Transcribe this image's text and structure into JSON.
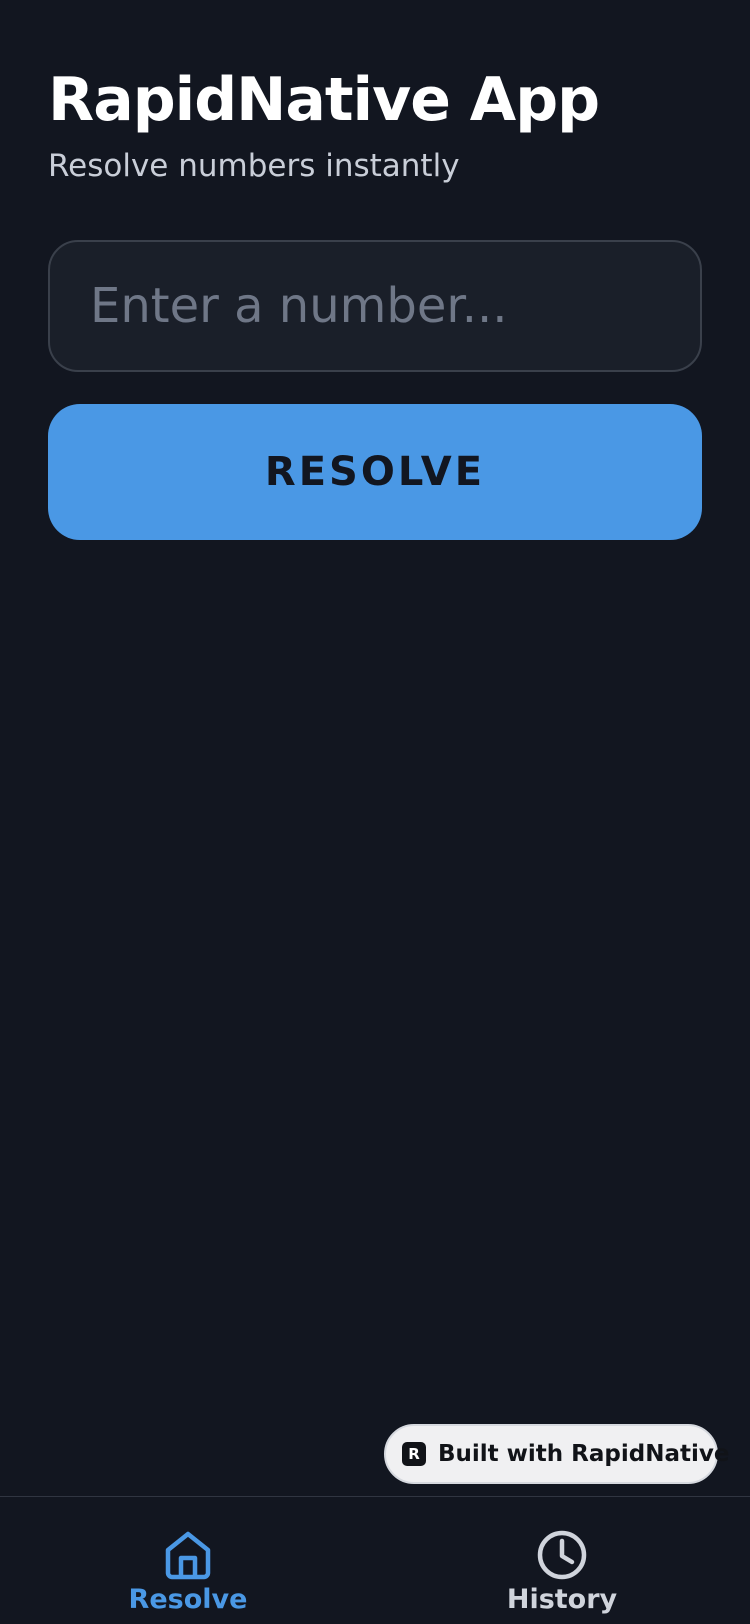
{
  "app": {
    "title": "RapidNative App",
    "subtitle": "Resolve numbers instantly"
  },
  "form": {
    "number_input": {
      "value": "",
      "placeholder": "Enter a number..."
    },
    "resolve_label": "RESOLVE"
  },
  "badge": {
    "label": "Built with RapidNative"
  },
  "bottom_nav": {
    "items": [
      {
        "label": "Resolve",
        "icon": "home-icon",
        "active": true
      },
      {
        "label": "History",
        "icon": "clock-icon",
        "active": false
      }
    ]
  },
  "colors": {
    "background": "#121620",
    "accent": "#4a98e5",
    "input_background": "#1a1f29",
    "input_border": "#3a404b",
    "badge_background": "#f0f0f2"
  }
}
